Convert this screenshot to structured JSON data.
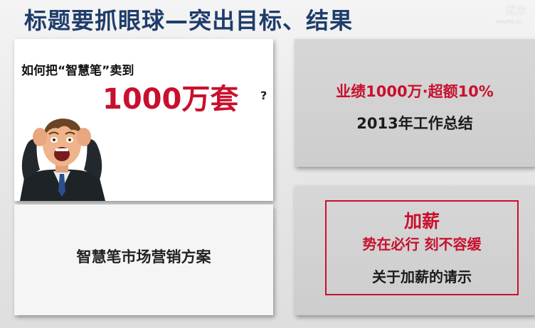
{
  "header": {
    "title": "标题要抓眼球—突出目标、结果",
    "watermark": "优米",
    "watermark_sub": "youmi.cn"
  },
  "example_sales": {
    "question": "如何把“智慧笔”卖到",
    "target": "1000万套",
    "question_mark": "?"
  },
  "example_plan": {
    "text": "智慧笔市场营销方案"
  },
  "example_summary": {
    "headline": "业绩1000万·超额10%",
    "subtitle": "2013年工作总结"
  },
  "example_raise": {
    "title": "加薪",
    "slogan": "势在必行 刻不容缓",
    "request": "关于加薪的请示"
  },
  "colors": {
    "title": "#1f3d6b",
    "accent_red": "#c8102e",
    "card_gray": "#d2d2d2"
  }
}
